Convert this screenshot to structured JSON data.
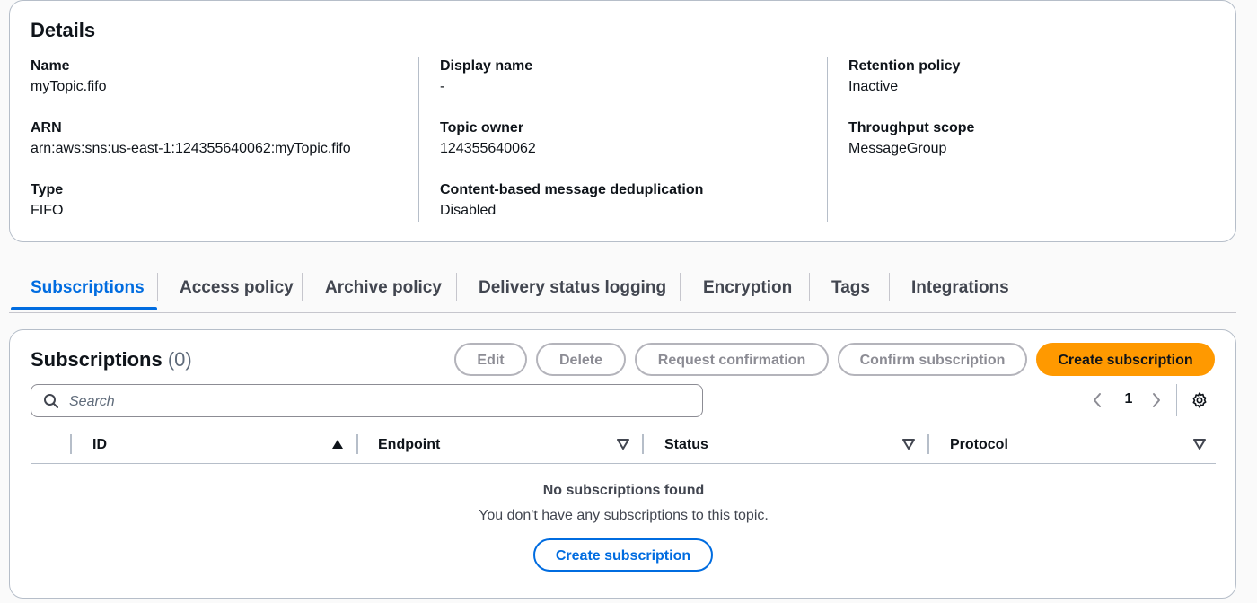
{
  "details": {
    "title": "Details",
    "fields": [
      {
        "label": "Name",
        "value": "myTopic.fifo"
      },
      {
        "label": "ARN",
        "value": "arn:aws:sns:us-east-1:124355640062:myTopic.fifo"
      },
      {
        "label": "Type",
        "value": "FIFO"
      },
      {
        "label": "Display name",
        "value": "-"
      },
      {
        "label": "Topic owner",
        "value": "124355640062"
      },
      {
        "label": "Content-based message deduplication",
        "value": "Disabled"
      },
      {
        "label": "Retention policy",
        "value": "Inactive"
      },
      {
        "label": "Throughput scope",
        "value": "MessageGroup"
      }
    ]
  },
  "tabs": [
    {
      "label": "Subscriptions",
      "active": true
    },
    {
      "label": "Access policy"
    },
    {
      "label": "Archive policy"
    },
    {
      "label": "Delivery status logging"
    },
    {
      "label": "Encryption"
    },
    {
      "label": "Tags"
    },
    {
      "label": "Integrations"
    }
  ],
  "subscriptions": {
    "title": "Subscriptions",
    "count": "(0)",
    "buttons": {
      "edit": "Edit",
      "delete": "Delete",
      "request_confirmation": "Request confirmation",
      "confirm_subscription": "Confirm subscription",
      "create_subscription": "Create subscription"
    },
    "search_placeholder": "Search",
    "page": "1",
    "columns": [
      "ID",
      "Endpoint",
      "Status",
      "Protocol"
    ],
    "empty_title": "No subscriptions found",
    "empty_desc": "You don't have any subscriptions to this topic.",
    "empty_button": "Create subscription"
  },
  "colors": {
    "accent": "#006ce0",
    "primary_button": "#ff9900",
    "border": "#b6bec9"
  },
  "icons": {
    "search": "search-icon",
    "prev": "chevron-left-icon",
    "next": "chevron-right-icon",
    "settings": "gear-icon",
    "sort_asc": "caret-up-icon",
    "sort": "caret-down-icon"
  }
}
